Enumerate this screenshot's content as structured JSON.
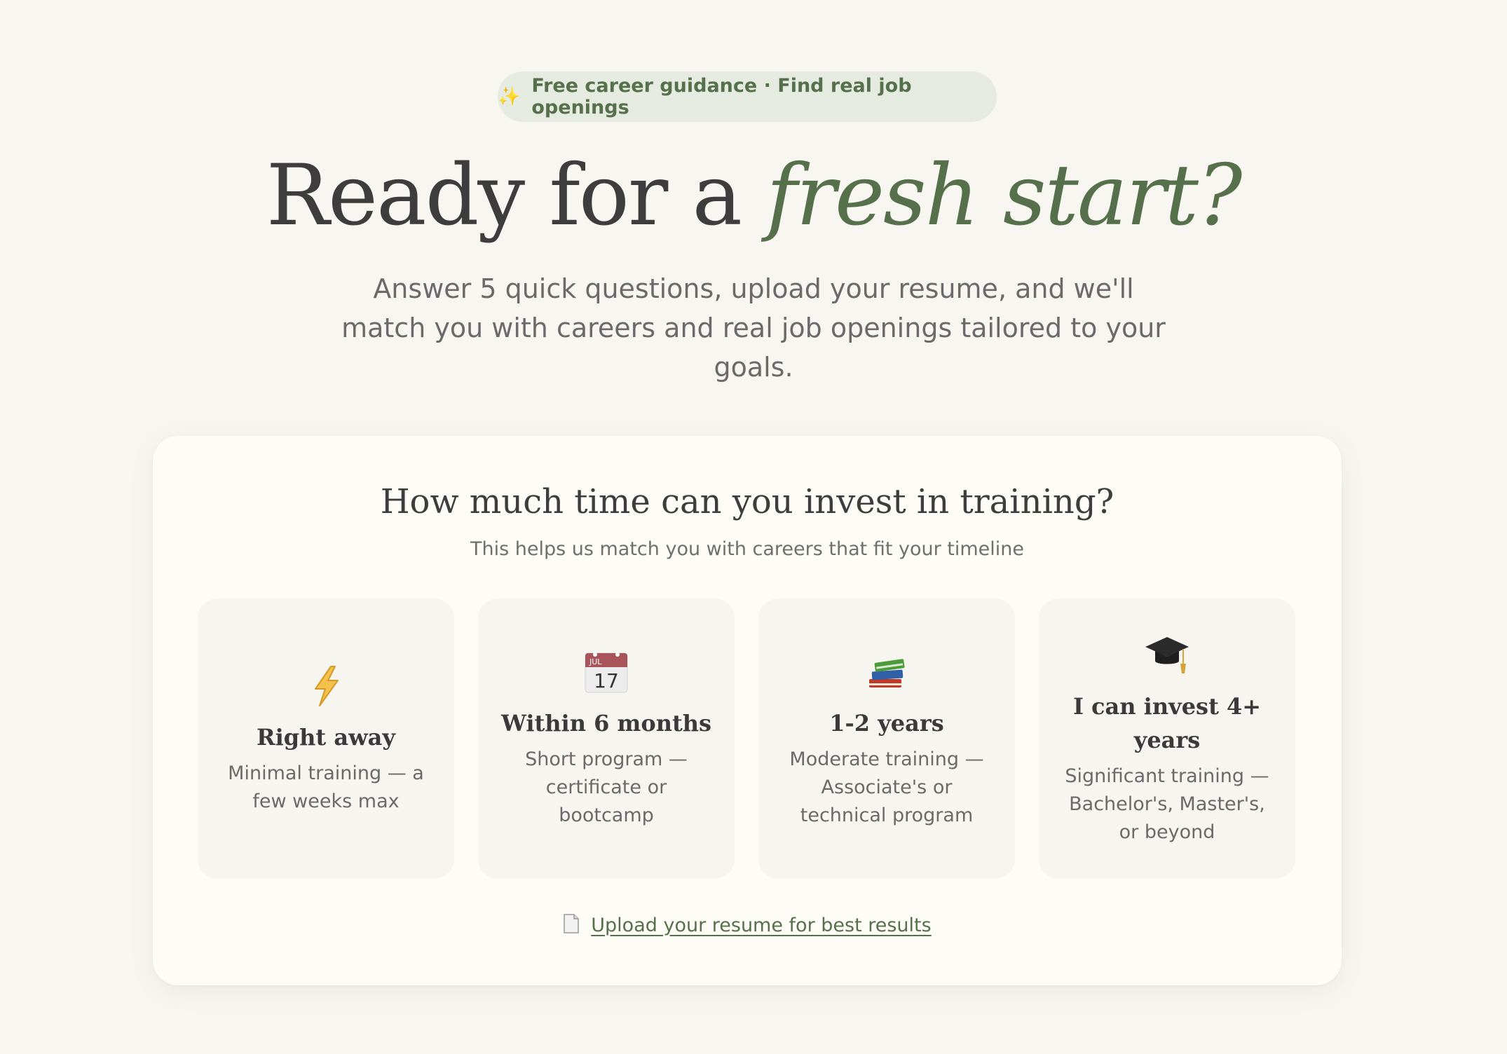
{
  "badge": {
    "icon": "sparkles-icon",
    "text": "Free career guidance · Find real job openings"
  },
  "hero": {
    "title_plain": "Ready for a ",
    "title_accent": "fresh start?",
    "subtitle": "Answer 5 quick questions, upload your resume, and we'll match you with careers and real job openings tailored to your goals."
  },
  "question": {
    "title": "How much time can you invest in training?",
    "subtitle": "This helps us match you with careers that fit your timeline",
    "options": [
      {
        "icon": "lightning-icon",
        "title": "Right away",
        "description": "Minimal training — a few weeks max"
      },
      {
        "icon": "calendar-icon",
        "calendar_month": "JUL",
        "calendar_day": "17",
        "title": "Within 6 months",
        "description": "Short program — certificate or bootcamp"
      },
      {
        "icon": "books-icon",
        "title": "1-2 years",
        "description": "Moderate training — Associate's or technical program"
      },
      {
        "icon": "graduation-cap-icon",
        "title": "I can invest 4+ years",
        "description": "Significant training — Bachelor's, Master's, or beyond"
      }
    ]
  },
  "upload": {
    "icon": "document-icon",
    "label": "Upload your resume for best results"
  },
  "colors": {
    "background": "#f8f6f1",
    "accent": "#55704a",
    "card": "#fefcf7",
    "option_bg": "#f7f5f0",
    "badge_bg": "#e6ebe2"
  }
}
